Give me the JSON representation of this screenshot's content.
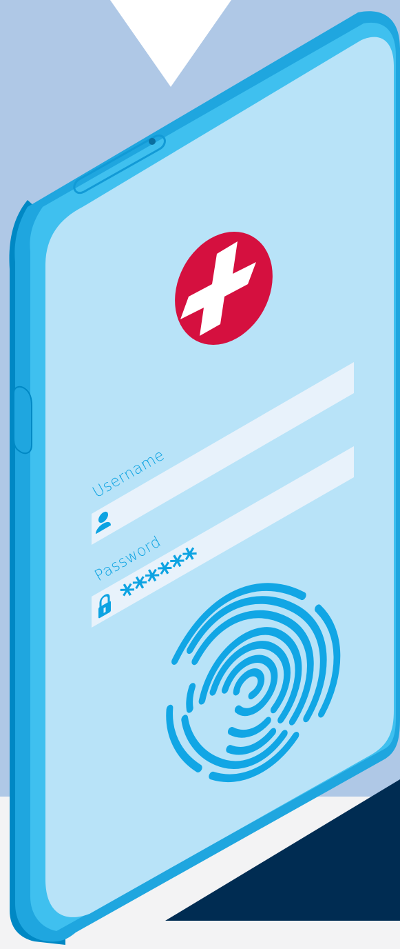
{
  "login_form": {
    "username_label": "Username",
    "username_value": "",
    "password_label": "Password",
    "password_masked": "******"
  },
  "icons": {
    "app_logo": "medical-cross-icon",
    "user": "user-icon",
    "lock": "lock-icon",
    "fingerprint": "fingerprint-icon",
    "side_button": "side-button",
    "earpiece": "earpiece"
  },
  "colors": {
    "background_top": "#afc8e6",
    "background_bottom": "#f3f3f4",
    "dark_panel": "#002c52",
    "phone_frame": "#1fa6df",
    "phone_frame_light": "#3fc0ef",
    "phone_edge": "#0088c4",
    "screen": "#b8e3f8",
    "field": "#e8f2fb",
    "accent_blue": "#0da3e2",
    "logo_red": "#d5103f",
    "logo_cross": "#ffffff"
  }
}
